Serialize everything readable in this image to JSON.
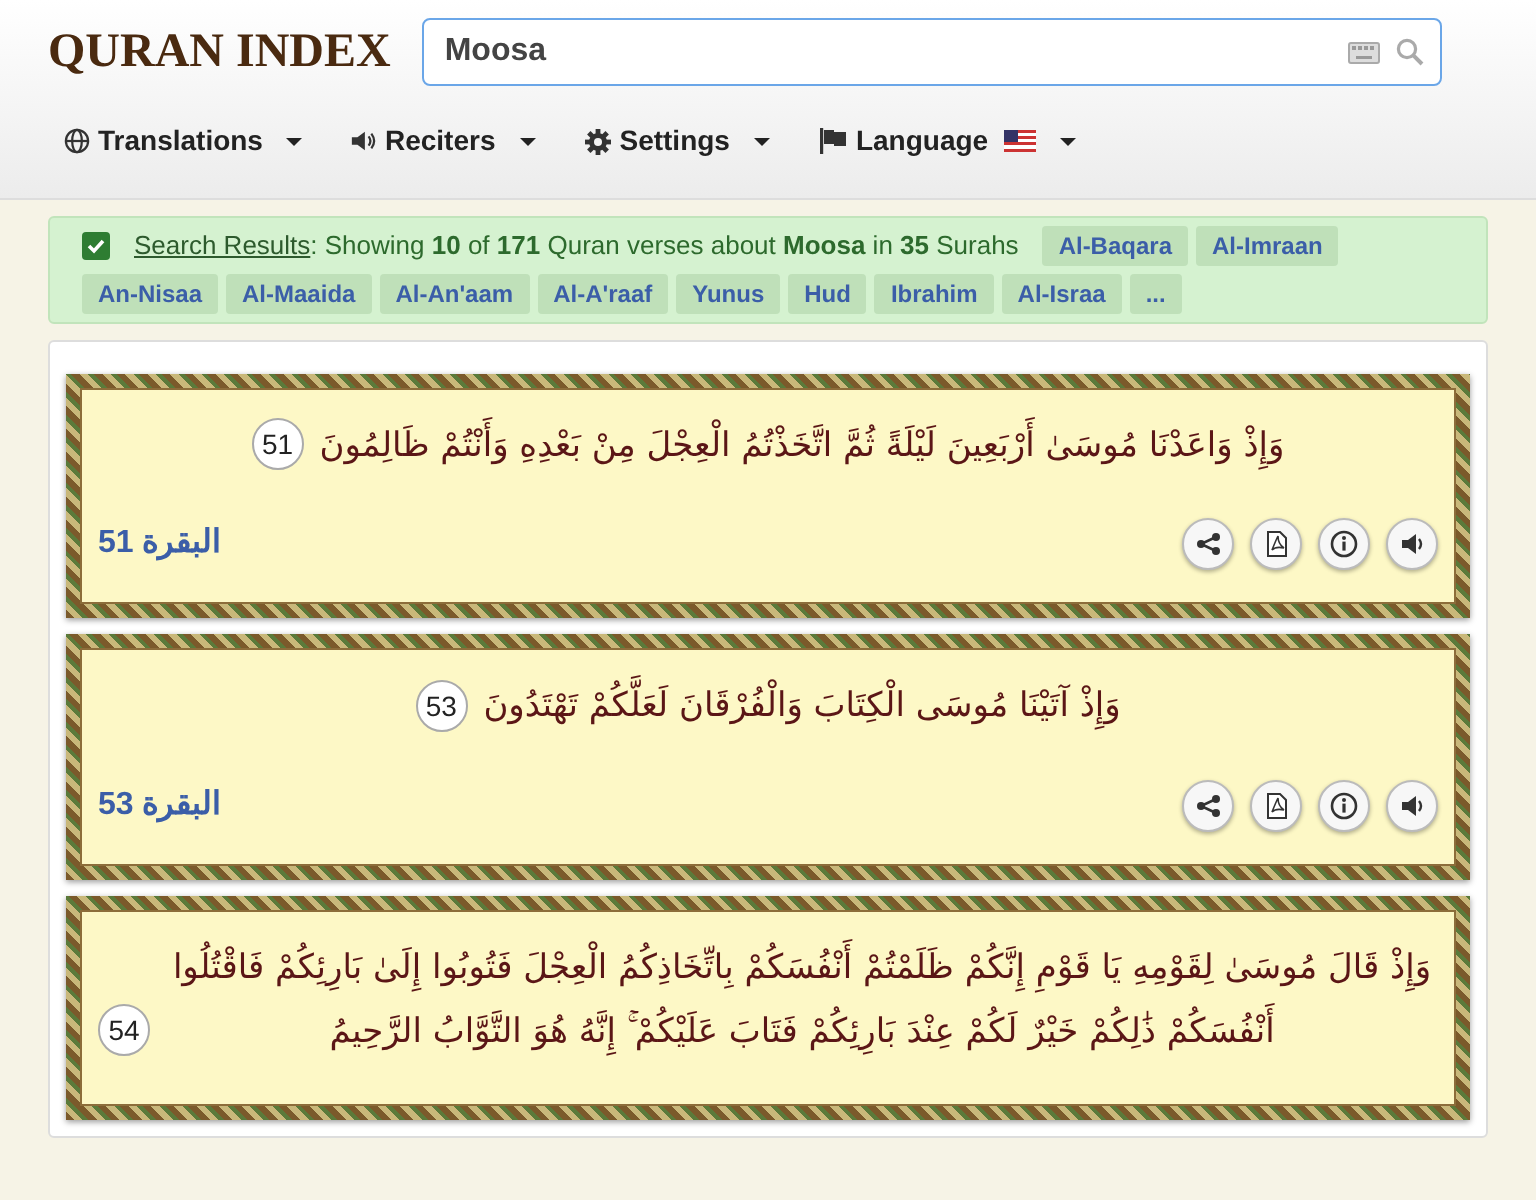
{
  "logo": "QURAN INDEX",
  "search": {
    "value": "Moosa"
  },
  "nav": [
    {
      "label": "Translations",
      "kind": "globe"
    },
    {
      "label": "Reciters",
      "kind": "speaker"
    },
    {
      "label": "Settings",
      "kind": "gear"
    },
    {
      "label": "Language",
      "kind": "flag"
    }
  ],
  "results": {
    "checked": true,
    "link": "Search Results",
    "summary": ": Showing **10** of **171** Quran verses about **Moosa** in **35** Surahs",
    "surahs": [
      "Al-Baqara",
      "Al-Imraan",
      "An-Nisaa",
      "Al-Maaida",
      "Al-An'aam",
      "Al-A'raaf",
      "Yunus",
      "Hud",
      "Ibrahim",
      "Al-Israa",
      "..."
    ]
  },
  "verses": [
    {
      "text": "وَإِذْ وَاعَدْنَا مُوسَىٰ أَرْبَعِينَ لَيْلَةً ثُمَّ اتَّخَذْتُمُ الْعِجْلَ مِنْ بَعْدِهِ وَأَنْتُمْ ظَالِمُونَ",
      "number": "51",
      "reference": "البقرة 51"
    },
    {
      "text": "وَإِذْ آتَيْنَا مُوسَى الْكِتَابَ وَالْفُرْقَانَ لَعَلَّكُمْ تَهْتَدُونَ",
      "number": "53",
      "reference": "البقرة 53"
    },
    {
      "text": "وَإِذْ قَالَ مُوسَىٰ لِقَوْمِهِ يَا قَوْمِ إِنَّكُمْ ظَلَمْتُمْ أَنْفُسَكُمْ بِاتِّخَاذِكُمُ الْعِجْلَ فَتُوبُوا إِلَىٰ بَارِئِكُمْ فَاقْتُلُوا أَنْفُسَكُمْ ذَٰلِكُمْ خَيْرٌ لَكُمْ عِنْدَ بَارِئِكُمْ فَتَابَ عَلَيْكُمْ ۚ إِنَّهُ هُوَ التَّوَّابُ الرَّحِيمُ",
      "number": "54"
    }
  ]
}
